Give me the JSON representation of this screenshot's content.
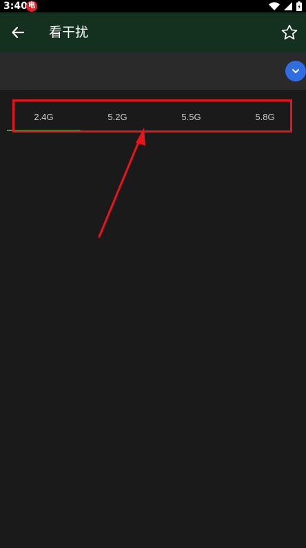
{
  "status_bar": {
    "time": "3:40",
    "notification_badge": "电",
    "icons": [
      "wifi-icon",
      "signal-icon",
      "battery-icon"
    ]
  },
  "app_bar": {
    "title": "看干扰",
    "back_icon": "arrow-left-icon",
    "favorite_icon": "star-outline-icon",
    "background_color": "#14301f"
  },
  "selector": {
    "dropdown_icon": "chevron-down-icon",
    "accent_color": "#2f6de1"
  },
  "tabs": [
    {
      "label": "2.4G",
      "selected": true
    },
    {
      "label": "5.2G",
      "selected": false
    },
    {
      "label": "5.5G",
      "selected": false
    },
    {
      "label": "5.8G",
      "selected": false
    }
  ],
  "tab_indicator_color": "#3a9a48",
  "annotation": {
    "highlight_color": "#e8141c",
    "arrow_color": "#e8141c"
  }
}
